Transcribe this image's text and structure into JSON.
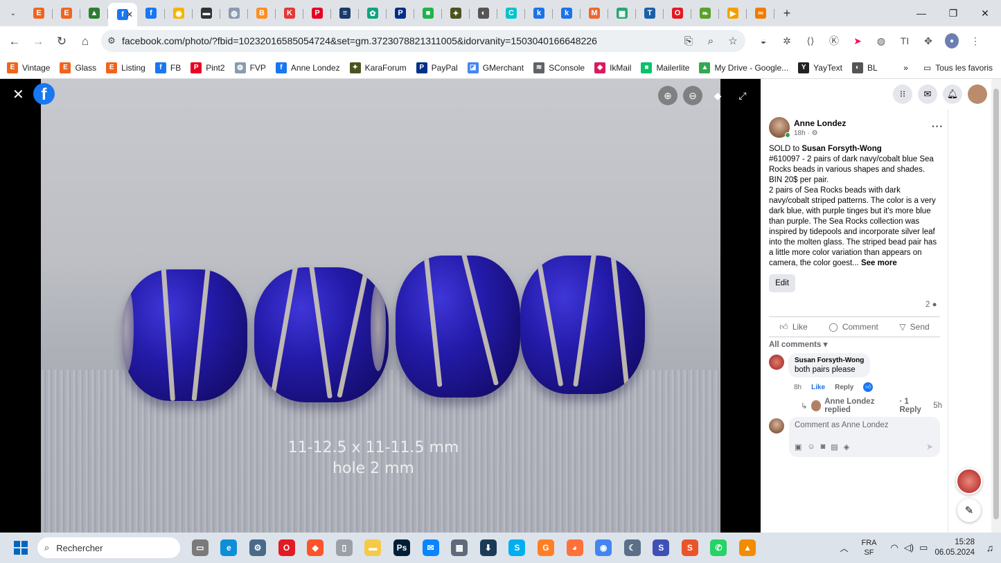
{
  "browser": {
    "tabs": [
      {
        "icon": "etsy-icon",
        "glyph": "E",
        "color": "#f1641e"
      },
      {
        "icon": "etsy-icon",
        "glyph": "E",
        "color": "#f1641e"
      },
      {
        "icon": "mountain-icon",
        "glyph": "▲",
        "color": "#2e7d32"
      },
      {
        "icon": "facebook-icon",
        "glyph": "f",
        "color": "#1877f2",
        "active": true
      },
      {
        "icon": "facebook-icon",
        "glyph": "f",
        "color": "#1877f2"
      },
      {
        "icon": "chrome-icon",
        "glyph": "◉",
        "color": "#f4b400"
      },
      {
        "icon": "video-icon",
        "glyph": "▬",
        "color": "#333333"
      },
      {
        "icon": "globe-icon",
        "glyph": "◍",
        "color": "#8a9bb0"
      },
      {
        "icon": "blogger-icon",
        "glyph": "B",
        "color": "#ff8f1f"
      },
      {
        "icon": "kiwi-icon",
        "glyph": "K",
        "color": "#e53935"
      },
      {
        "icon": "pinterest-icon",
        "glyph": "P",
        "color": "#e60023"
      },
      {
        "icon": "spool-icon",
        "glyph": "≡",
        "color": "#1a3a6b"
      },
      {
        "icon": "openai-icon",
        "glyph": "✿",
        "color": "#10a37f"
      },
      {
        "icon": "paypal-icon",
        "glyph": "P",
        "color": "#003087"
      },
      {
        "icon": "chat-icon",
        "glyph": "■",
        "color": "#21b24b"
      },
      {
        "icon": "turtle-icon",
        "glyph": "✦",
        "color": "#4b5320"
      },
      {
        "icon": "globe-icon",
        "glyph": "◐",
        "color": "#555555"
      },
      {
        "icon": "canva-icon",
        "glyph": "C",
        "color": "#00c4cc"
      },
      {
        "icon": "klaviyo-icon",
        "glyph": "k",
        "color": "#1c73e8"
      },
      {
        "icon": "klaviyo-icon",
        "glyph": "k",
        "color": "#1c73e8"
      },
      {
        "icon": "magento-icon",
        "glyph": "M",
        "color": "#ee672f"
      },
      {
        "icon": "grid-icon",
        "glyph": "▦",
        "color": "#2ba672"
      },
      {
        "icon": "text-icon",
        "glyph": "T",
        "color": "#1b5fa8"
      },
      {
        "icon": "opera-icon",
        "glyph": "O",
        "color": "#e21a23"
      },
      {
        "icon": "leaf-icon",
        "glyph": "❧",
        "color": "#5aa02c"
      },
      {
        "icon": "play-icon",
        "glyph": "▶",
        "color": "#f2a100"
      },
      {
        "icon": "dash-icon",
        "glyph": "∞",
        "color": "#f07c00"
      }
    ],
    "window_controls": {
      "minimize": "—",
      "maximize": "❐",
      "close": "✕"
    },
    "url": "facebook.com/photo/?fbid=10232016585054724&set=gm.3723078821311005&idorvanity=1503040166648226",
    "bookmarks": [
      {
        "label": "Vintage",
        "glyph": "E",
        "color": "#f1641e",
        "icon": "etsy-icon"
      },
      {
        "label": "Glass",
        "glyph": "E",
        "color": "#f1641e",
        "icon": "etsy-icon"
      },
      {
        "label": "Listing",
        "glyph": "E",
        "color": "#f1641e",
        "icon": "etsy-icon"
      },
      {
        "label": "FB",
        "glyph": "f",
        "color": "#1877f2",
        "icon": "facebook-icon"
      },
      {
        "label": "Pint2",
        "glyph": "P",
        "color": "#e60023",
        "icon": "pinterest-icon"
      },
      {
        "label": "FVP",
        "glyph": "◍",
        "color": "#8a9bb0",
        "icon": "globe-icon"
      },
      {
        "label": "Anne Londez",
        "glyph": "f",
        "color": "#1877f2",
        "icon": "facebook-icon"
      },
      {
        "label": "KaraForum",
        "glyph": "✦",
        "color": "#4b5320",
        "icon": "turtle-icon"
      },
      {
        "label": "PayPal",
        "glyph": "P",
        "color": "#003087",
        "icon": "paypal-icon"
      },
      {
        "label": "GMerchant",
        "glyph": "◪",
        "color": "#4285f4",
        "icon": "merchant-icon"
      },
      {
        "label": "SConsole",
        "glyph": "≋",
        "color": "#5f6368",
        "icon": "console-icon"
      },
      {
        "label": "IkMail",
        "glyph": "◆",
        "color": "#d81b60",
        "icon": "mail-icon"
      },
      {
        "label": "Mailerlite",
        "glyph": "■",
        "color": "#09c269",
        "icon": "mailerlite-icon"
      },
      {
        "label": "My Drive - Google...",
        "glyph": "▲",
        "color": "#34a853",
        "icon": "drive-icon"
      },
      {
        "label": "YayText",
        "glyph": "Y",
        "color": "#222222",
        "icon": "yaytext-icon"
      },
      {
        "label": "BL",
        "glyph": "◐",
        "color": "#555555",
        "icon": "globe-icon"
      }
    ],
    "all_bookmarks": "Tous les favoris"
  },
  "viewer": {
    "caption_line1": "11-12.5 x 11-11.5 mm",
    "caption_line2": "hole 2 mm"
  },
  "post": {
    "author": "Anne Londez",
    "time": "18h · ⚙",
    "sold_prefix": "SOLD to ",
    "buyer": "Susan Forsyth-Wong",
    "body": "#610097 - 2 pairs of dark navy/cobalt blue Sea Rocks beads in various shapes and shades.\nBIN 20$ per pair.\n2 pairs of Sea Rocks beads with dark navy/cobalt striped patterns. The color is a very dark blue, with purple tinges but it's more blue than purple. The Sea Rocks collection was inspired by tidepools and incorporate silver leaf into the molten glass. The striped bead pair has a little more color variation than appears on camera, the color goest...",
    "see_more": "See more",
    "edit": "Edit",
    "comment_count": "2",
    "actions": {
      "like": "Like",
      "comment": "Comment",
      "send": "Send"
    },
    "all_comments": "All comments",
    "comment": {
      "name": "Susan Forsyth-Wong",
      "text": "both pairs please",
      "time": "8h",
      "like": "Like",
      "reply": "Reply"
    },
    "reply_summary": {
      "name": "Anne Londez replied",
      "count": "· 1 Reply",
      "time": "5h"
    },
    "compose_placeholder": "Comment as Anne Londez"
  },
  "taskbar": {
    "search_placeholder": "Rechercher",
    "apps": [
      {
        "icon": "file-explorer-icon",
        "glyph": "▭",
        "color": "#7a7a7a"
      },
      {
        "icon": "edge-icon",
        "glyph": "e",
        "color": "#0c8fd6"
      },
      {
        "icon": "settings-icon",
        "glyph": "⚙",
        "color": "#4a6a8a"
      },
      {
        "icon": "opera-icon",
        "glyph": "O",
        "color": "#e21a23"
      },
      {
        "icon": "brave-icon",
        "glyph": "◆",
        "color": "#fb542b"
      },
      {
        "icon": "document-icon",
        "glyph": "▯",
        "color": "#9aa0a6"
      },
      {
        "icon": "folder-icon",
        "glyph": "▬",
        "color": "#f7c948"
      },
      {
        "icon": "photoshop-icon",
        "glyph": "Ps",
        "color": "#001e36"
      },
      {
        "icon": "thunderbird-icon",
        "glyph": "✉",
        "color": "#0a84ff"
      },
      {
        "icon": "calculator-icon",
        "glyph": "▦",
        "color": "#5f6b7a"
      },
      {
        "icon": "download-icon",
        "glyph": "⬇",
        "color": "#1b3a57"
      },
      {
        "icon": "skype-icon",
        "glyph": "S",
        "color": "#00aff0"
      },
      {
        "icon": "g-app-icon",
        "glyph": "G",
        "color": "#ff7f27"
      },
      {
        "icon": "firefox-icon",
        "glyph": "◕",
        "color": "#ff7139"
      },
      {
        "icon": "chrome-icon",
        "glyph": "◉",
        "color": "#4285f4"
      },
      {
        "icon": "moon-icon",
        "glyph": "☾",
        "color": "#5b6f88"
      },
      {
        "icon": "s-app-icon",
        "glyph": "S",
        "color": "#3f51b5"
      },
      {
        "icon": "s-app-icon",
        "glyph": "S",
        "color": "#e8552b"
      },
      {
        "icon": "whatsapp-icon",
        "glyph": "✆",
        "color": "#25d366"
      },
      {
        "icon": "vlc-icon",
        "glyph": "▲",
        "color": "#f28c00"
      }
    ],
    "lang": "FRA",
    "lang2": "SF",
    "time": "15:28",
    "date": "06.05.2024"
  }
}
